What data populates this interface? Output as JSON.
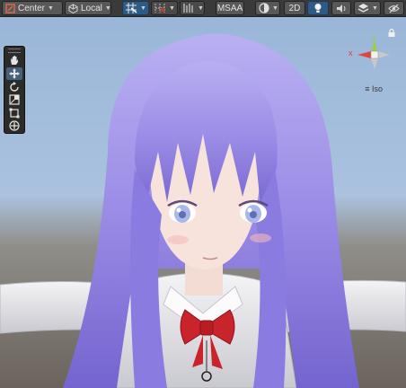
{
  "toolbar": {
    "pivot_label": "Center",
    "space_label": "Local",
    "msaa_label": "MSAA",
    "mode_2d_label": "2D"
  },
  "gizmo": {
    "x_axis_label": "x",
    "y_axis_label": "y",
    "projection_label": "Iso"
  },
  "colors": {
    "toolbar_bg": "#3a3a3a",
    "button_active": "#2d5b86",
    "axis_x": "#e0443a",
    "axis_y": "#9ad23a",
    "axis_z": "#3d7ae0"
  },
  "icons": {
    "tools": [
      "hand-icon",
      "move-icon",
      "rotate-icon",
      "scale-icon",
      "rect-icon",
      "transform-icon"
    ],
    "toolbar": [
      "pivot-icon",
      "local-space-icon",
      "grid-snap-icon",
      "increment-snap-icon",
      "snap-settings-icon",
      "shading-mode-icon",
      "lighting-icon",
      "audio-icon",
      "effects-icon",
      "hidden-objects-icon"
    ]
  }
}
